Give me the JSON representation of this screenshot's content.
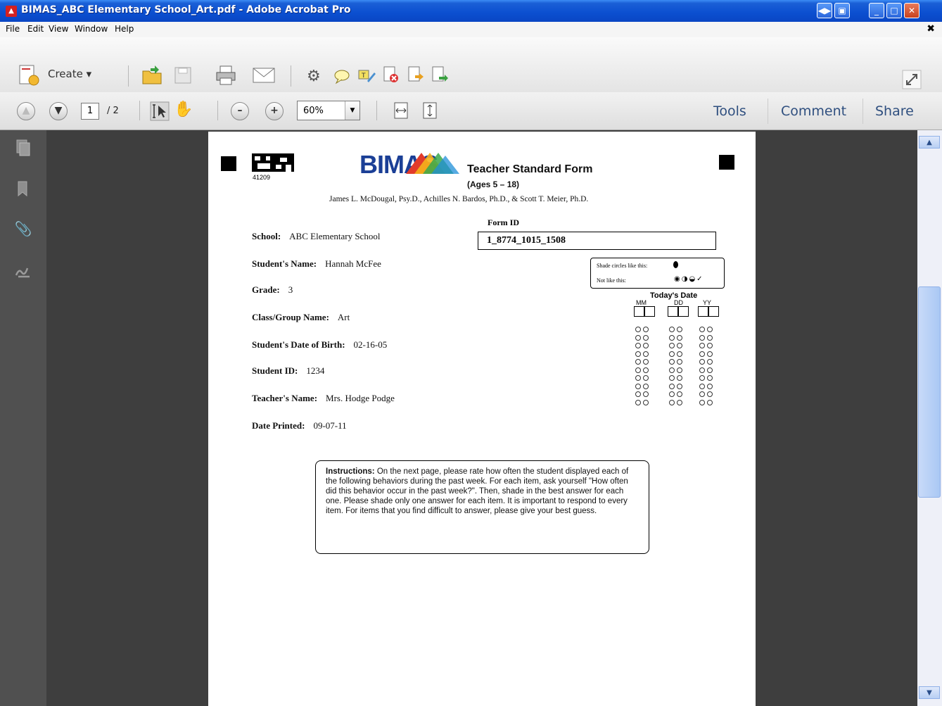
{
  "window": {
    "title": "BIMAS_ABC Elementary School_Art.pdf - Adobe Acrobat Pro"
  },
  "menu": [
    "File",
    "Edit",
    "View",
    "Window",
    "Help"
  ],
  "toolbar": {
    "create_label": "Create",
    "icons": [
      "open-icon",
      "save-icon",
      "print-icon",
      "email-icon",
      "settings-icon",
      "comment-icon",
      "highlight-icon",
      "pdf-delete-icon",
      "export-icon",
      "share-icon"
    ]
  },
  "nav": {
    "current_page": "1",
    "total_pages": "/ 2",
    "zoom": "60%"
  },
  "right_panel": {
    "tools": "Tools",
    "comment": "Comment",
    "share": "Share"
  },
  "doc": {
    "barcode_number": "41209",
    "logo": "BIMAS",
    "form_title": "Teacher Standard Form",
    "ages": "(Ages 5 – 18)",
    "authors": "James L. McDougal, Psy.D., Achilles N. Bardos, Ph.D., & Scott T. Meier, Ph.D.",
    "form_id_label": "Form ID",
    "form_id": "1_8774_1015_1508",
    "fields": [
      {
        "label": "School:",
        "value": "ABC Elementary School"
      },
      {
        "label": "Student's Name:",
        "value": "Hannah McFee"
      },
      {
        "label": "Grade:",
        "value": "3"
      },
      {
        "label": "Class/Group Name:",
        "value": "Art"
      },
      {
        "label": "Student's Date of Birth:",
        "value": "02-16-05"
      },
      {
        "label": "Student ID:",
        "value": "1234"
      },
      {
        "label": "Teacher's Name:",
        "value": "Mrs. Hodge Podge"
      },
      {
        "label": "Date Printed:",
        "value": "09-07-11"
      }
    ],
    "shade_like": "Shade circles like this:",
    "not_like": "Not like this:",
    "todays_date": "Today's Date",
    "date_cols": [
      "MM",
      "DD",
      "YY"
    ],
    "instructions_label": "Instructions:",
    "instructions_text": "On the next page, please rate how often the student displayed each of the following behaviors during the past week. For each item, ask yourself \"How often did this behavior occur in the past week?\". Then, shade in the best answer for each one. Please shade only one answer for each item. It is important to respond to every item. For items that you find difficult to answer, please give your best guess."
  }
}
